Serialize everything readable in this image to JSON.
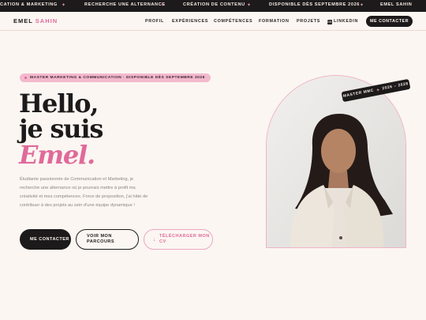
{
  "ticker": {
    "items": [
      "CATION & MARKETING",
      "RECHERCHE UNE ALTERNANCE",
      "CRÉATION DE CONTENU",
      "DISPONIBLE DÈS SEPTEMBRE 2026",
      "EMEL SAHIN"
    ],
    "separator": "✦"
  },
  "nav": {
    "brand_first": "EMEL",
    "brand_last": "SAHIN",
    "links": [
      "PROFIL",
      "EXPÉRIENCES",
      "COMPÉTENCES",
      "FORMATION",
      "PROJETS"
    ],
    "linkedin_icon": "linkedin-icon",
    "linkedin": "LINKEDIN",
    "cta": "ME CONTACTER"
  },
  "hero": {
    "badge": "MASTER MARKETING & COMMUNICATION · DISPONIBLE DÈS SEPTEMBRE 2026",
    "line1": "Hello,",
    "line2": "je suis",
    "line3": "Emel.",
    "description": "Étudiante passionnée de Communication et Marketing, je recherche une alternance où je pourrais mettre à profit ma créativité et mes compétences. Force de proposition, j'ai hâte de contribuer à des projets au sein d'une équipe dynamique !",
    "buttons": {
      "contact": "ME CONTACTER",
      "parcours": "VOIR MON PARCOURS",
      "cv": "TÉLÉCHARGER MON CV"
    },
    "download_icon": "download-icon",
    "stamp_left": "MASTER MMC",
    "stamp_sep": "✦",
    "stamp_right": "2026 – 2028"
  },
  "colors": {
    "accent": "#e06a9a",
    "dark": "#1c1a1a",
    "background": "#fbf6f2",
    "badge": "#f3b9cd"
  }
}
